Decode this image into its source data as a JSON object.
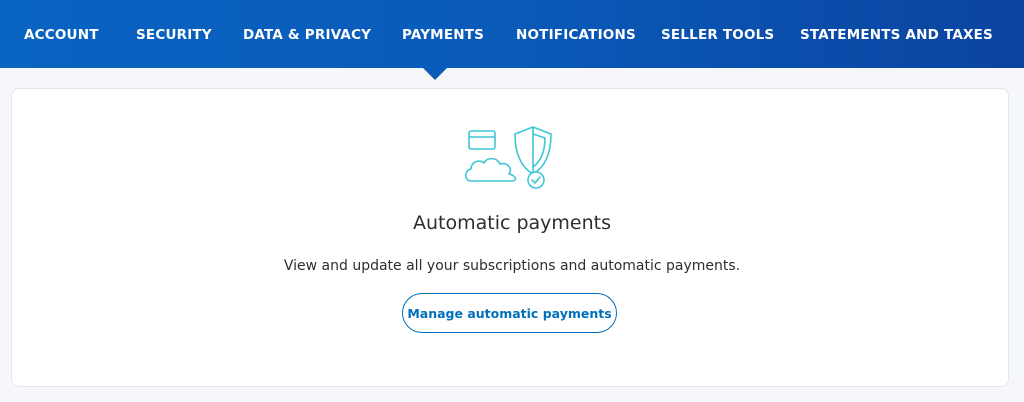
{
  "nav": {
    "items": [
      {
        "label": "ACCOUNT"
      },
      {
        "label": "SECURITY"
      },
      {
        "label": "DATA & PRIVACY"
      },
      {
        "label": "PAYMENTS"
      },
      {
        "label": "NOTIFICATIONS"
      },
      {
        "label": "SELLER TOOLS"
      },
      {
        "label": "STATEMENTS AND TAXES"
      }
    ],
    "active": "PAYMENTS"
  },
  "card": {
    "illustration_icon": "cloud-card-shield-check-icon",
    "title": "Automatic payments",
    "description": "View and update all your subscriptions and automatic payments.",
    "button_label": "Manage automatic payments"
  },
  "colors": {
    "nav_bg": "#0a5ab8",
    "accent": "#0070ba",
    "illustration": "#3ec6d4"
  }
}
